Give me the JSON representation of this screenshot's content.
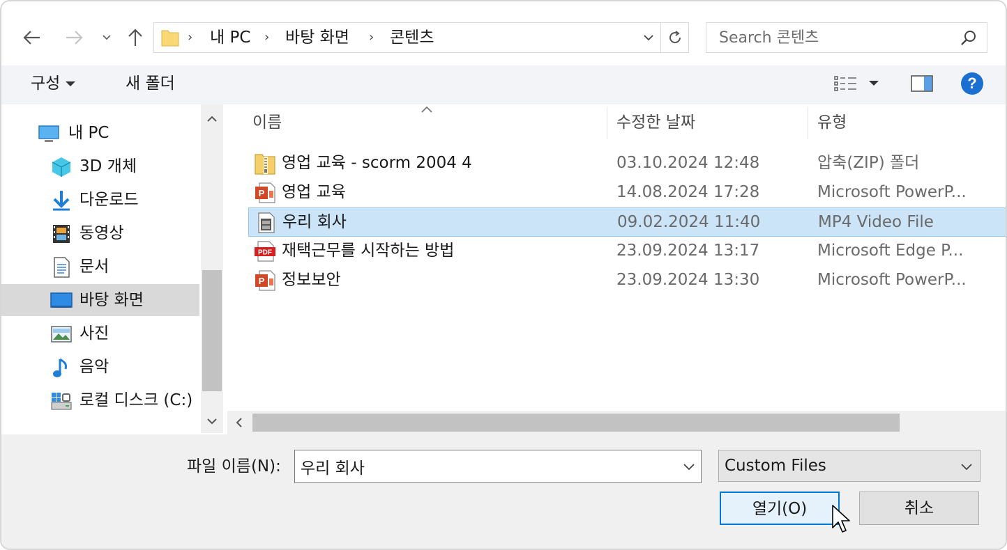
{
  "navigation": {
    "back_icon": "arrow-left-icon",
    "forward_icon": "arrow-right-icon",
    "recent_icon": "chevron-down-icon",
    "up_icon": "arrow-up-icon"
  },
  "address": {
    "crumbs": [
      "내 PC",
      "바탕 화면",
      "콘텐츠"
    ],
    "refresh_icon": "refresh-icon"
  },
  "search": {
    "placeholder": "Search 콘텐츠"
  },
  "toolbar": {
    "organize_label": "구성",
    "new_folder_label": "새 폴더"
  },
  "nav_pane": {
    "items": [
      {
        "label": "내 PC",
        "icon": "pc-icon"
      },
      {
        "label": "3D 개체",
        "icon": "cube-icon"
      },
      {
        "label": "다운로드",
        "icon": "download-icon"
      },
      {
        "label": "동영상",
        "icon": "video-icon"
      },
      {
        "label": "문서",
        "icon": "document-icon"
      },
      {
        "label": "바탕 화면",
        "icon": "desktop-icon",
        "selected": true
      },
      {
        "label": "사진",
        "icon": "picture-icon"
      },
      {
        "label": "음악",
        "icon": "music-icon"
      },
      {
        "label": "로컬 디스크 (C:)",
        "icon": "disk-icon"
      }
    ]
  },
  "file_list": {
    "columns": {
      "name": "이름",
      "modified": "수정한 날짜",
      "type": "유형"
    },
    "rows": [
      {
        "name": "영업 교육 - scorm 2004 4",
        "modified": "03.10.2024 12:48",
        "type": "압축(ZIP) 폴더",
        "icon": "zip-folder-icon"
      },
      {
        "name": "영업 교육",
        "modified": "14.08.2024 17:28",
        "type": "Microsoft PowerP...",
        "icon": "powerpoint-icon"
      },
      {
        "name": "우리 회사",
        "modified": "09.02.2024 11:40",
        "type": "MP4 Video File",
        "icon": "video-file-icon",
        "selected": true
      },
      {
        "name": "재택근무를 시작하는 방법",
        "modified": "23.09.2024 13:17",
        "type": "Microsoft Edge P...",
        "icon": "pdf-icon"
      },
      {
        "name": "정보보안",
        "modified": "23.09.2024 13:30",
        "type": "Microsoft PowerP...",
        "icon": "powerpoint-icon"
      }
    ]
  },
  "footer": {
    "filename_label": "파일 이름(N):",
    "filename_value": "우리 회사",
    "filetype_value": "Custom Files",
    "open_label": "열기(O)",
    "cancel_label": "취소"
  },
  "colors": {
    "accent": "#0078d7",
    "selection": "#cce4f7",
    "toolbar_bg": "#f2f4f8",
    "help": "#1a6fd0"
  }
}
